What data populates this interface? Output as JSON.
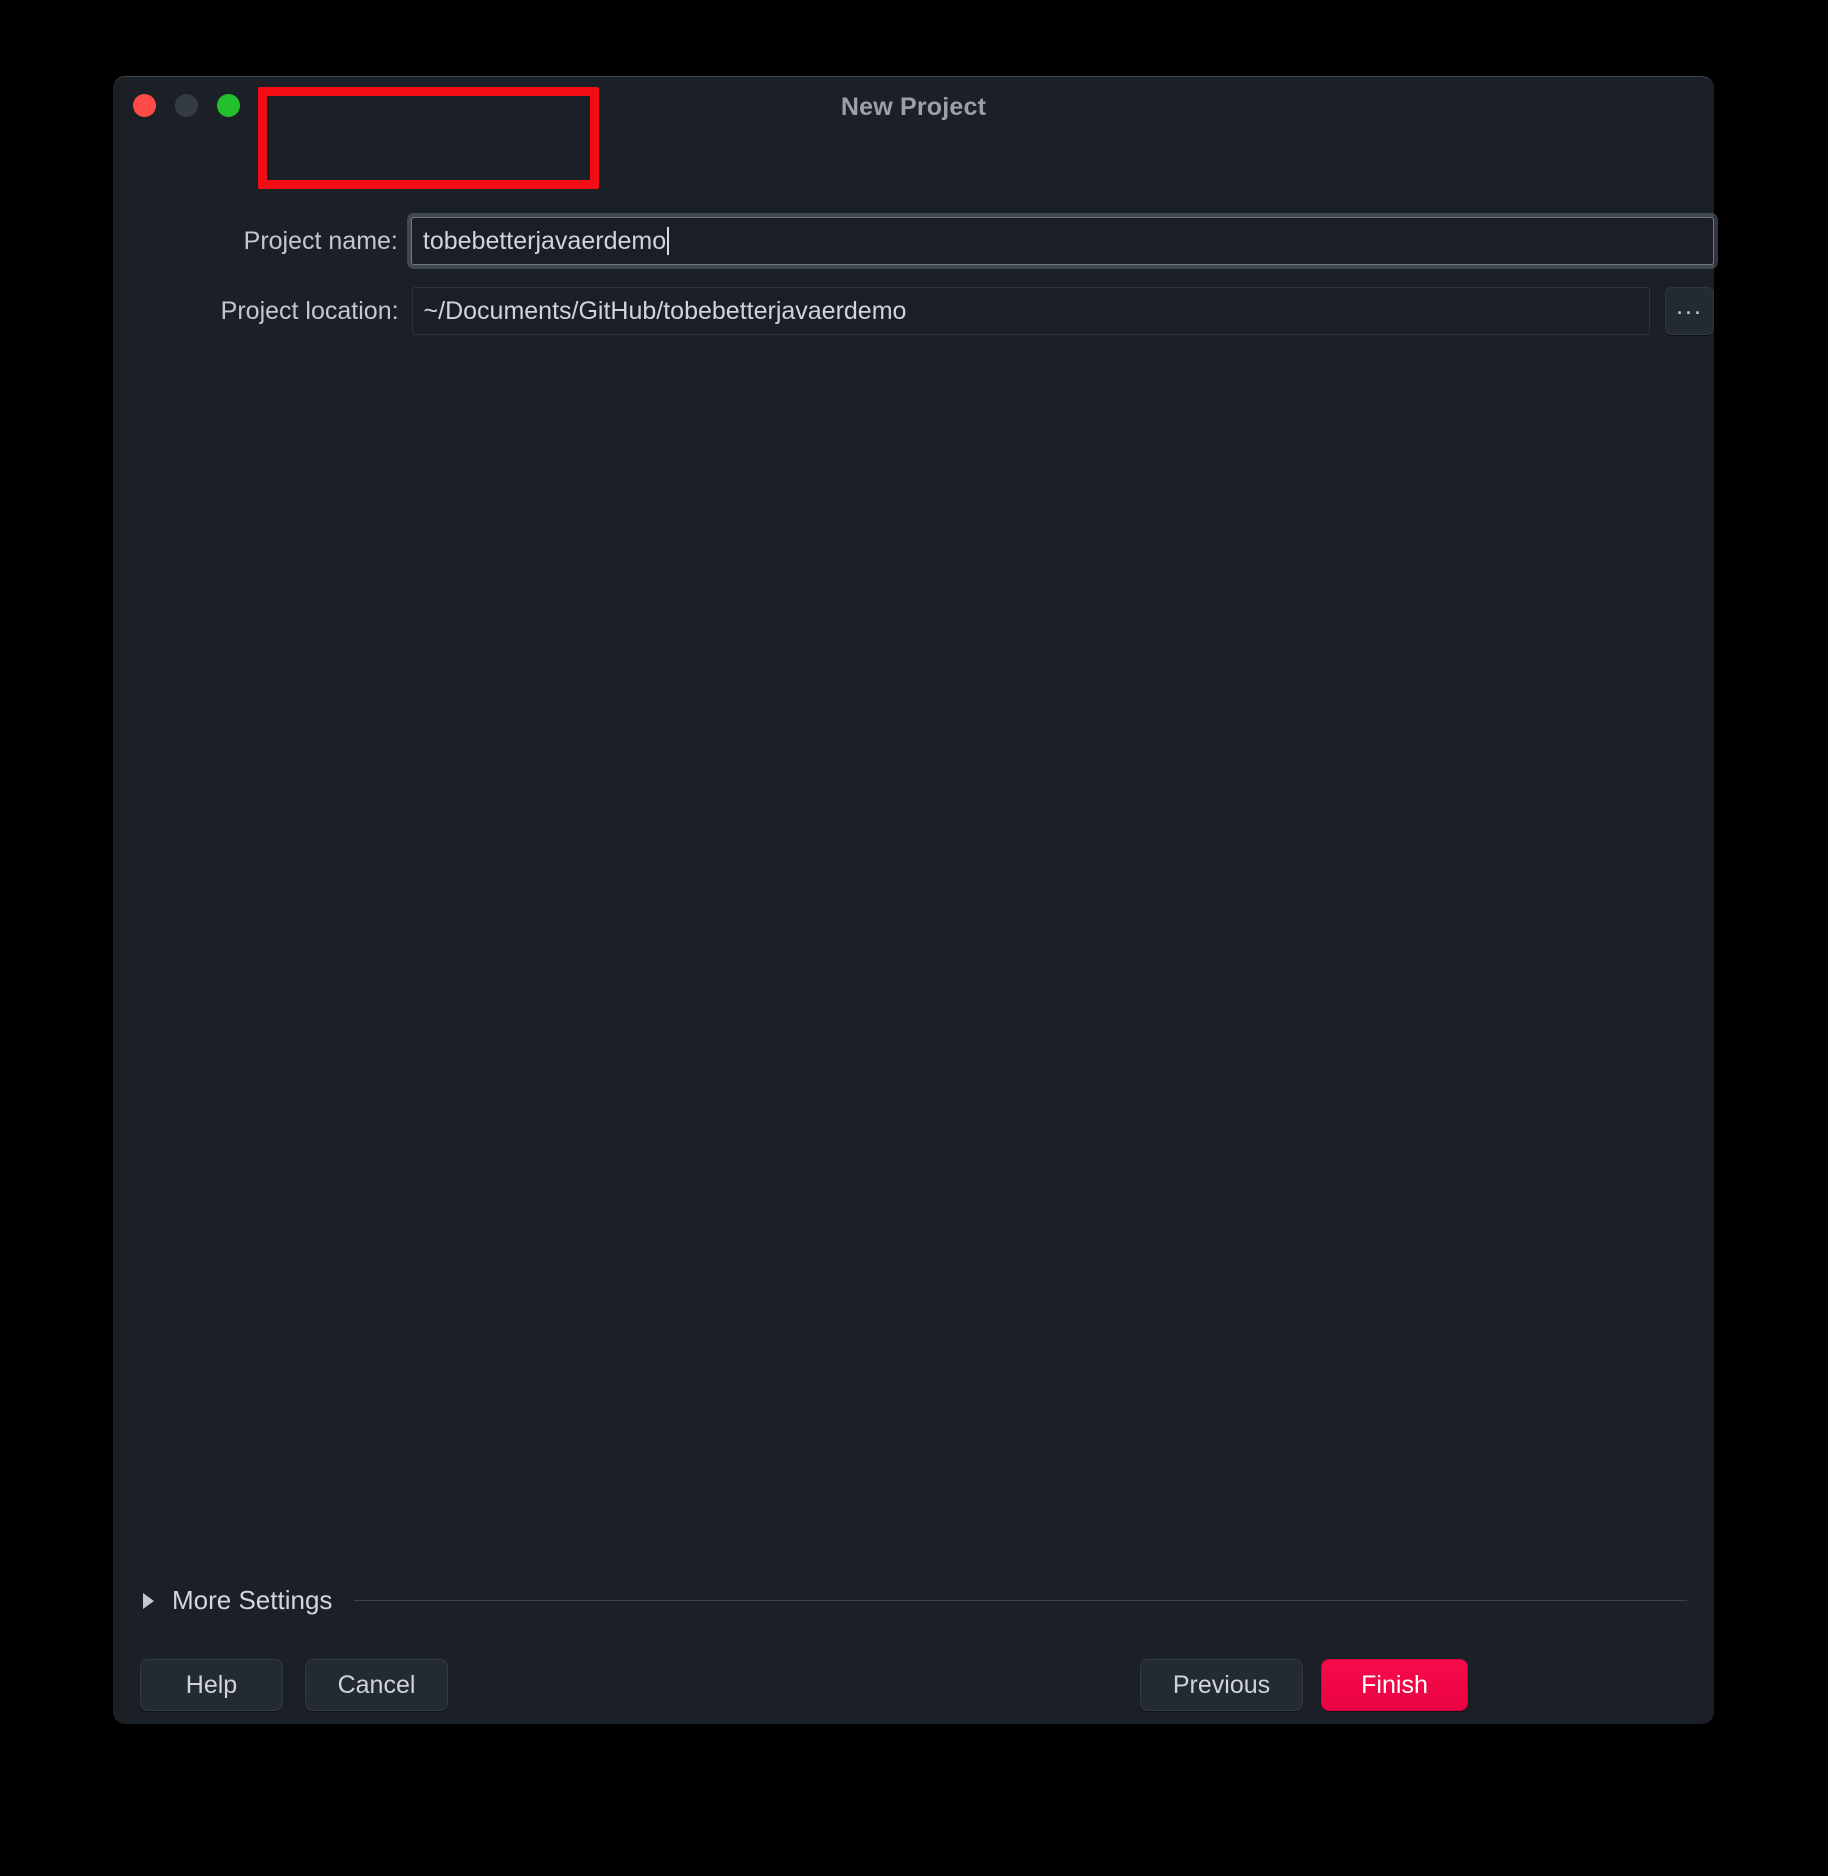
{
  "window": {
    "title": "New Project",
    "traffic_lights": [
      {
        "name": "close",
        "color": "#FE4B45"
      },
      {
        "name": "minimize",
        "color": "#343B43"
      },
      {
        "name": "zoom",
        "color": "#22C02C"
      }
    ],
    "background_color": "#1B2027"
  },
  "form": {
    "project_name": {
      "label": "Project name:",
      "value": "tobebetterjavaerdemo",
      "placeholder": "Project name",
      "focused": true
    },
    "project_location": {
      "label": "Project location:",
      "value": "~/Documents/GitHub/tobebetterjavaerdemo",
      "placeholder": "Project location",
      "browse_label": "..."
    }
  },
  "more_settings": {
    "label": "More Settings",
    "expanded": false,
    "triangle_icon": "triangle-right-icon"
  },
  "buttons": {
    "help": "Help",
    "cancel": "Cancel",
    "previous": "Previous",
    "finish": "Finish",
    "finish_color": "#F30C46"
  },
  "annotation": {
    "type": "highlight-rectangle",
    "color": "#F30C14",
    "target": "project-name-input"
  }
}
